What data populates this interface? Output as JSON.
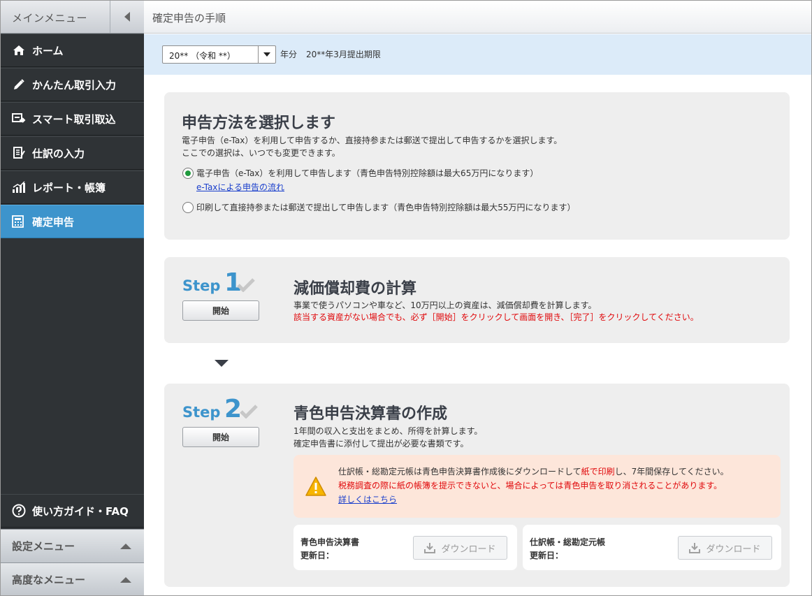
{
  "sidebar": {
    "top_label": "メインメニュー",
    "items": [
      {
        "label": "ホーム",
        "icon": "home-icon"
      },
      {
        "label": "かんたん取引入力",
        "icon": "pencil-icon"
      },
      {
        "label": "スマート取引取込",
        "icon": "import-icon"
      },
      {
        "label": "仕訳の入力",
        "icon": "journal-icon"
      },
      {
        "label": "レポート・帳簿",
        "icon": "chart-icon"
      },
      {
        "label": "確定申告",
        "icon": "calculator-icon",
        "active": true
      }
    ],
    "guide_label": "使い方ガイド・FAQ",
    "settings_label": "設定メニュー",
    "advanced_label": "高度なメニュー"
  },
  "header": {
    "title": "確定申告の手順"
  },
  "yearbar": {
    "selected_year": "20** （令和 **）",
    "year_suffix": "年分",
    "deadline": "20**年3月提出期限"
  },
  "method": {
    "title": "申告方法を選択します",
    "desc1": "電子申告（e-Tax）を利用して申告するか、直接持参または郵送で提出して申告するかを選択します。",
    "desc2": "ここでの選択は、いつでも変更できます。",
    "option1": "電子申告（e-Tax）を利用して申告します（青色申告特別控除額は最大65万円になります）",
    "option1_link": "e-Taxによる申告の流れ",
    "option2": "印刷して直接持参または郵送で提出して申告します（青色申告特別控除額は最大55万円になります）",
    "selected": 1
  },
  "step1": {
    "step_word": "Step",
    "step_num": "1",
    "start_label": "開始",
    "title": "減価償却費の計算",
    "desc": "事業で使うパソコンや車など、10万円以上の資産は、減価償却費を計算します。",
    "note": "該当する資産がない場合でも、必ず［開始］をクリックして画面を開き、［完了］をクリックしてください。"
  },
  "step2": {
    "step_word": "Step",
    "step_num": "2",
    "start_label": "開始",
    "title": "青色申告決算書の作成",
    "desc1": "1年間の収入と支出をまとめ、所得を計算します。",
    "desc2": "確定申告書に添付して提出が必要な書類です。",
    "warn_line1_a": "仕訳帳・総勘定元帳は青色申告決算書作成後にダウンロードして",
    "warn_line1_b": "紙で印刷",
    "warn_line1_c": "し、7年間保存してください。",
    "warn_line2": "税務調査の際に紙の帳簿を提示できないと、場合によっては青色申告を取り消されることがあります。",
    "warn_link": "詳しくはこちら",
    "cards": [
      {
        "name": "青色申告決算書",
        "updated_label": "更新日：",
        "button": "ダウンロード"
      },
      {
        "name": "仕訳帳・総勘定元帳",
        "updated_label": "更新日：",
        "button": "ダウンロード"
      }
    ]
  }
}
